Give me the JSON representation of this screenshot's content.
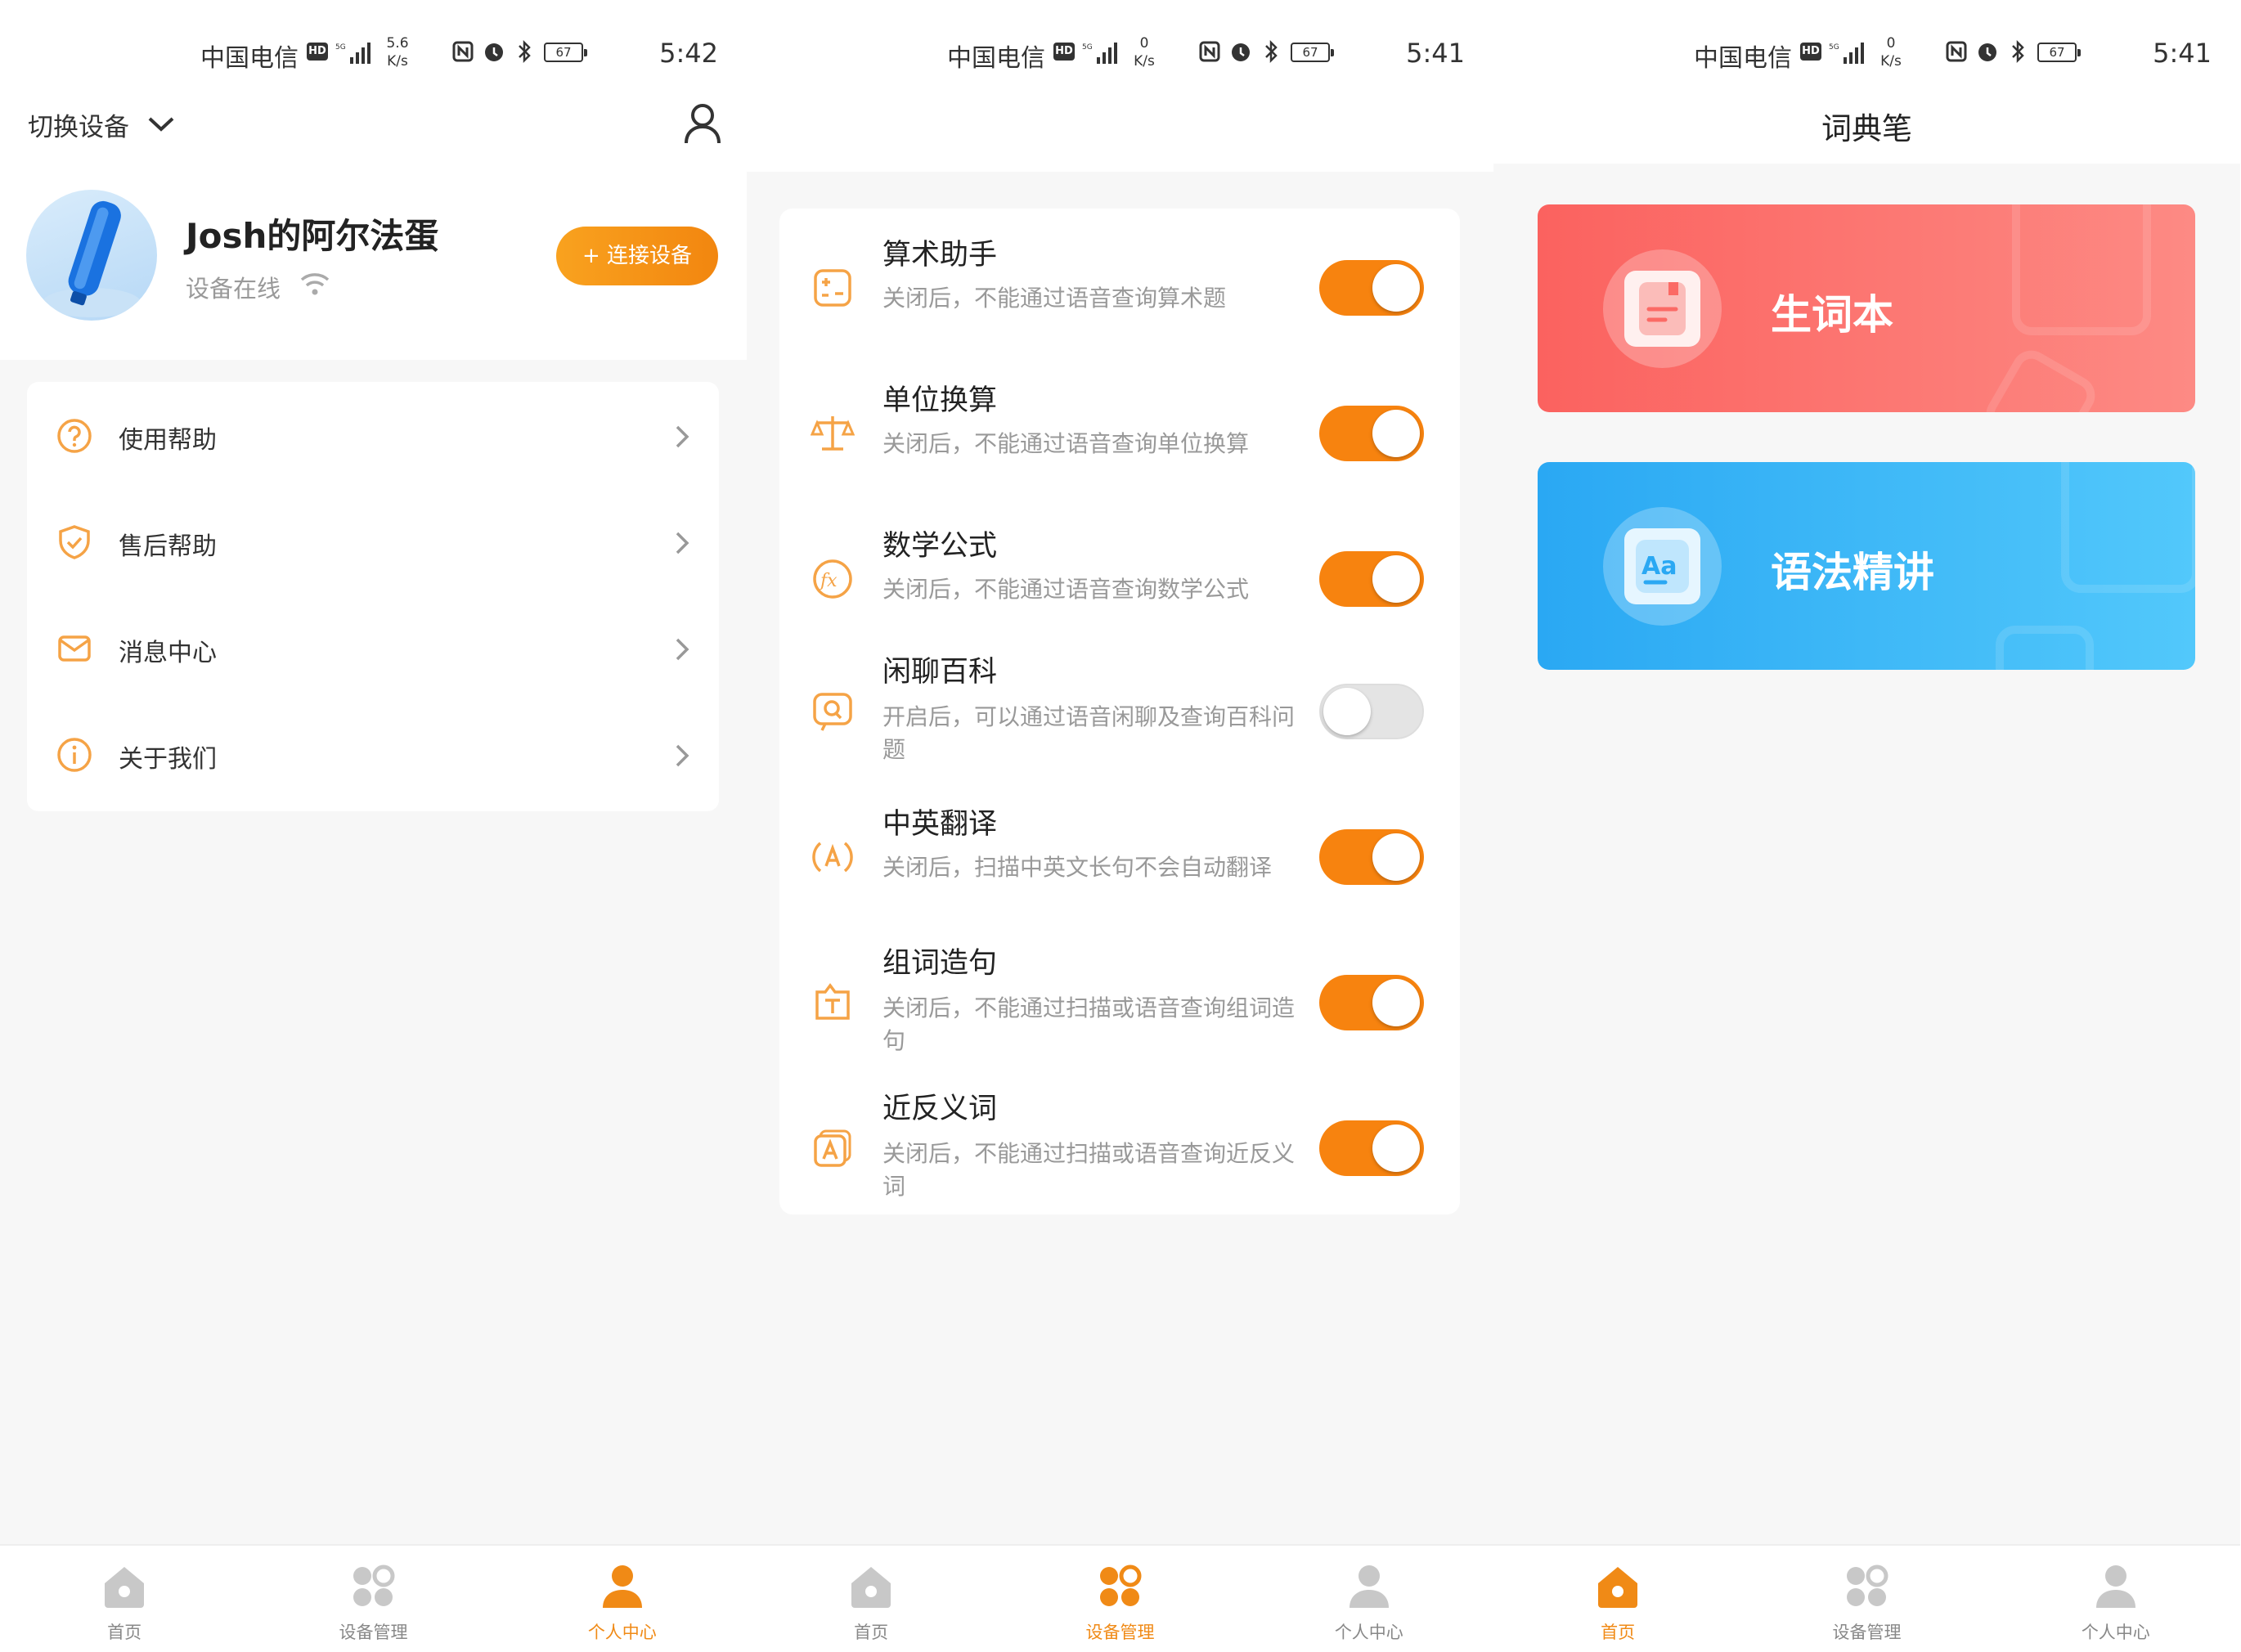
{
  "status_bars": [
    {
      "carrier": "中国电信",
      "hd": "HD",
      "speed_value": "5.6",
      "speed_unit": "K/s",
      "battery": "67",
      "time": "5:42"
    },
    {
      "carrier": "中国电信",
      "hd": "HD",
      "speed_value": "0",
      "speed_unit": "K/s",
      "battery": "67",
      "time": "5:41"
    },
    {
      "carrier": "中国电信",
      "hd": "HD",
      "speed_value": "0",
      "speed_unit": "K/s",
      "battery": "67",
      "time": "5:41"
    }
  ],
  "profile": {
    "switch_device": "切换设备",
    "device_name": "Josh的阿尔法蛋",
    "device_status": "设备在线",
    "connect_button": "+ 连接设备",
    "menu": [
      {
        "label": "使用帮助",
        "icon": "question-circle-icon"
      },
      {
        "label": "售后帮助",
        "icon": "shield-check-icon"
      },
      {
        "label": "消息中心",
        "icon": "mail-icon"
      },
      {
        "label": "关于我们",
        "icon": "info-circle-icon"
      }
    ]
  },
  "device_settings": [
    {
      "title": "算术助手",
      "desc": "关闭后，不能通过语音查询算术题",
      "enabled": true,
      "icon": "calculator-icon"
    },
    {
      "title": "单位换算",
      "desc": "关闭后，不能通过语音查询单位换算",
      "enabled": true,
      "icon": "balance-scale-icon"
    },
    {
      "title": "数学公式",
      "desc": "关闭后，不能通过语音查询数学公式",
      "enabled": true,
      "icon": "function-fx-icon"
    },
    {
      "title": "闲聊百科",
      "desc": "开启后，可以通过语音闲聊及查询百科问题",
      "enabled": false,
      "icon": "chat-search-icon"
    },
    {
      "title": "中英翻译",
      "desc": "关闭后，扫描中英文长句不会自动翻译",
      "enabled": true,
      "icon": "translate-icon"
    },
    {
      "title": "组词造句",
      "desc": "关闭后，不能通过扫描或语音查询组词造句",
      "enabled": true,
      "icon": "sentence-icon"
    },
    {
      "title": "近反义词",
      "desc": "关闭后，不能通过扫描或语音查询近反义词",
      "enabled": true,
      "icon": "synonym-icon"
    }
  ],
  "home": {
    "title": "词典笔",
    "cards": [
      {
        "label": "生词本",
        "color": "#fb6a65",
        "icon": "notebook-icon"
      },
      {
        "label": "语法精讲",
        "color": "#33b0f5",
        "icon": "grammar-aa-icon"
      }
    ]
  },
  "tabbar": {
    "items": [
      "首页",
      "设备管理",
      "个人中心"
    ],
    "active_color": "#f08a16",
    "inactive_color": "#c8c8c8"
  }
}
